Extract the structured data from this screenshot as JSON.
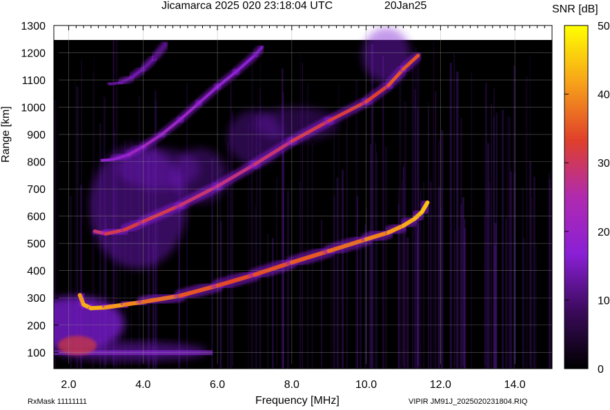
{
  "header": {
    "title": "Jicamarca 2025 020 23:18:04 UTC",
    "date": "20Jan25"
  },
  "footer": {
    "rxmask": "RxMask 11111111",
    "file": "VIPIR  JM91J_2025020231804.RIQ"
  },
  "chart_data": {
    "type": "heatmap",
    "title": "Jicamarca 2025 020 23:18:04 UTC",
    "xlabel": "Frequency [MHz]",
    "ylabel": "Range [km]",
    "xlim": [
      1.6,
      15.0
    ],
    "ylim": [
      40,
      1300
    ],
    "x_ticks": [
      "2.0",
      "4.0",
      "6.0",
      "8.0",
      "10.0",
      "12.0",
      "14.0"
    ],
    "x_tick_values": [
      2,
      4,
      6,
      8,
      10,
      12,
      14
    ],
    "y_ticks": [
      "100",
      "200",
      "300",
      "400",
      "500",
      "600",
      "700",
      "800",
      "900",
      "1000",
      "1100",
      "1200",
      "1300"
    ],
    "y_tick_values": [
      100,
      200,
      300,
      400,
      500,
      600,
      700,
      800,
      900,
      1000,
      1100,
      1200,
      1300
    ],
    "grid": true,
    "colorbar": {
      "label": "SNR [dB]",
      "range": [
        0,
        50
      ],
      "ticks": [
        "0",
        "10",
        "20",
        "30",
        "40",
        "50"
      ],
      "tick_values": [
        0,
        10,
        20,
        30,
        40,
        50
      ],
      "colors": [
        "#000000",
        "#3a0a5a",
        "#8a1fd6",
        "#b02ab0",
        "#e0402a",
        "#f7a21a",
        "#ffff00"
      ]
    },
    "series": [
      {
        "x": [
          2.3,
          2.4,
          2.6,
          3.0,
          3.5,
          4.0,
          5.0,
          6.0,
          7.0,
          8.0,
          9.0,
          10.0,
          10.6,
          11.0,
          11.3,
          11.5,
          11.65
        ],
        "y": [
          310,
          275,
          262,
          265,
          275,
          285,
          308,
          345,
          385,
          430,
          472,
          515,
          540,
          565,
          590,
          615,
          650
        ],
        "snr": [
          40,
          42,
          44,
          42,
          40,
          38,
          36,
          34,
          34,
          35,
          36,
          38,
          40,
          42,
          43,
          44,
          45
        ]
      },
      {
        "x": [
          2.7,
          3.0,
          3.5,
          4.0,
          5.0,
          6.0,
          7.0,
          8.0,
          9.0,
          10.0,
          10.6,
          11.0,
          11.4
        ],
        "y": [
          545,
          535,
          550,
          580,
          640,
          710,
          790,
          875,
          950,
          1020,
          1080,
          1140,
          1190
        ],
        "snr": [
          28,
          30,
          32,
          32,
          30,
          28,
          28,
          30,
          32,
          32,
          34,
          36,
          34
        ]
      },
      {
        "x": [
          2.9,
          3.2,
          3.6,
          4.0,
          4.5,
          5.0,
          5.5,
          6.0,
          6.5,
          7.0,
          7.2
        ],
        "y": [
          805,
          808,
          825,
          855,
          900,
          955,
          1015,
          1075,
          1130,
          1190,
          1220
        ],
        "snr": [
          18,
          18,
          20,
          22,
          22,
          20,
          20,
          18,
          18,
          16,
          14
        ]
      },
      {
        "x": [
          3.1,
          3.4,
          3.7,
          4.0,
          4.3,
          4.6
        ],
        "y": [
          1085,
          1090,
          1110,
          1140,
          1180,
          1230
        ],
        "snr": [
          12,
          12,
          14,
          14,
          12,
          10
        ]
      }
    ]
  }
}
